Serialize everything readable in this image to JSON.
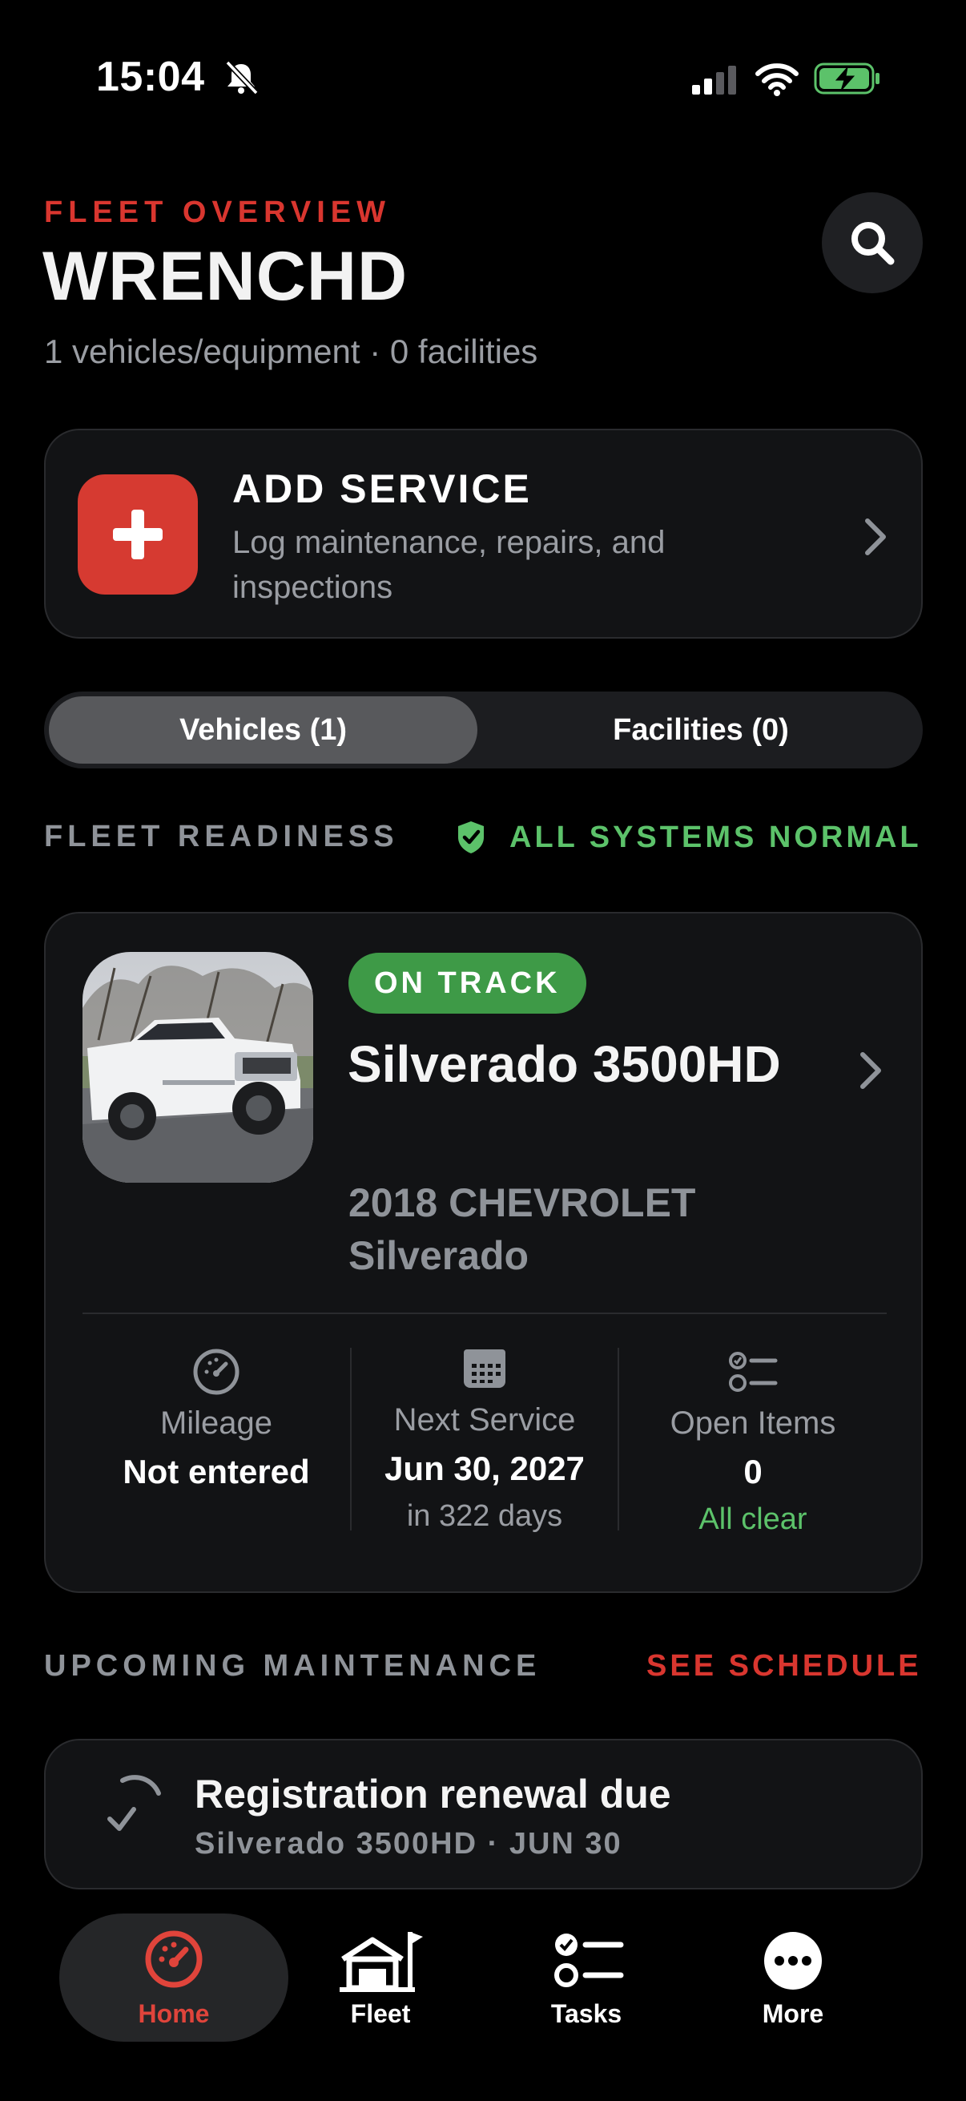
{
  "status_bar": {
    "time": "15:04"
  },
  "header": {
    "eyebrow": "FLEET OVERVIEW",
    "title": "WRENCHD",
    "subtitle": "1 vehicles/equipment · 0 facilities"
  },
  "add_service": {
    "title": "ADD SERVICE",
    "description": "Log maintenance, repairs, and inspections"
  },
  "segmented": {
    "tabs": [
      {
        "label": "Vehicles (1)",
        "selected": true
      },
      {
        "label": "Facilities (0)",
        "selected": false
      }
    ]
  },
  "readiness": {
    "label": "FLEET READINESS",
    "status": "ALL SYSTEMS NORMAL"
  },
  "vehicle": {
    "badge": "ON TRACK",
    "name": "Silverado 3500HD",
    "subtitle": "2018 CHEVROLET Silverado",
    "stats": [
      {
        "label": "Mileage",
        "value": "Not entered",
        "note": ""
      },
      {
        "label": "Next Service",
        "value": "Jun 30, 2027",
        "note": "in 322 days"
      },
      {
        "label": "Open Items",
        "value": "0",
        "note": "All clear"
      }
    ]
  },
  "upcoming": {
    "label": "UPCOMING MAINTENANCE",
    "action": "SEE SCHEDULE",
    "items": [
      {
        "title": "Registration renewal due",
        "subtitle": "Silverado 3500HD · JUN 30"
      }
    ]
  },
  "tab_bar": {
    "tabs": [
      {
        "label": "Home",
        "icon": "speedometer-icon",
        "active": true
      },
      {
        "label": "Fleet",
        "icon": "garage-flag-icon",
        "active": false
      },
      {
        "label": "Tasks",
        "icon": "checklist-icon",
        "active": false
      },
      {
        "label": "More",
        "icon": "more-icon",
        "active": false
      }
    ]
  },
  "colors": {
    "accent_red": "#d9362f",
    "success_green": "#5cc26a",
    "badge_green": "#3e9a47",
    "card_bg": "#121315"
  }
}
